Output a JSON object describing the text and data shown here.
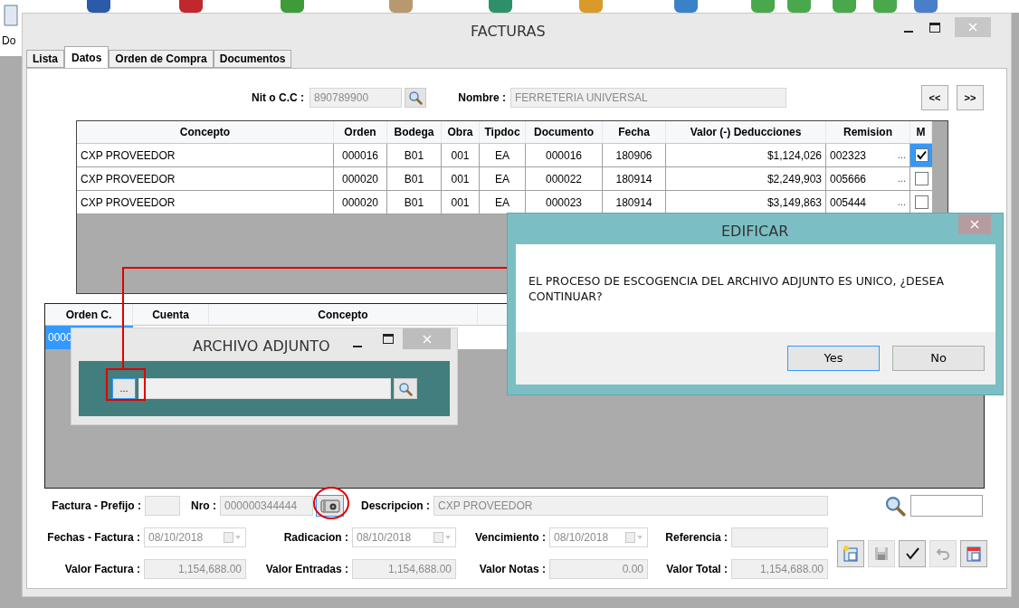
{
  "desktop": {
    "label": "Do"
  },
  "window": {
    "title": "FACTURAS"
  },
  "tabs": [
    {
      "label": "Lista",
      "selected": false
    },
    {
      "label": "Datos",
      "selected": true
    },
    {
      "label": "Orden de Compra",
      "selected": false
    },
    {
      "label": "Documentos",
      "selected": false
    }
  ],
  "header": {
    "nit_label": "Nit o C.C :",
    "nit_value": "890789900",
    "nombre_label": "Nombre :",
    "nombre_value": "FERRETERIA UNIVERSAL",
    "prev_button": "<<",
    "next_button": ">>"
  },
  "detail_table": {
    "columns": [
      "Concepto",
      "Orden",
      "Bodega",
      "Obra",
      "Tipdoc",
      "Documento",
      "Fecha",
      "Valor (-) Deducciones",
      "Remision",
      "M"
    ],
    "rows": [
      {
        "cells": [
          "CXP PROVEEDOR",
          "000016",
          "B01",
          "001",
          "EA",
          "000016",
          "180906",
          "$1,124,026",
          "002323"
        ],
        "remision_button": "...",
        "marked": true
      },
      {
        "cells": [
          "CXP PROVEEDOR",
          "000020",
          "B01",
          "001",
          "EA",
          "000022",
          "180914",
          "$2,249,903",
          "005666"
        ],
        "remision_button": "...",
        "marked": false
      },
      {
        "cells": [
          "CXP PROVEEDOR",
          "000020",
          "B01",
          "001",
          "EA",
          "000023",
          "180914",
          "$3,149,863",
          "005444"
        ],
        "remision_button": "...",
        "marked": false
      }
    ]
  },
  "orders_table": {
    "columns": [
      "Orden C.",
      "Cuenta",
      "Concepto"
    ],
    "rows": [
      {
        "cells": [
          "0000"
        ],
        "selected": true
      }
    ]
  },
  "form": {
    "rows": [
      [
        {
          "kind": "text",
          "label": "Factura - Prefijo :"
        },
        {
          "kind": "text",
          "label": "Nro :",
          "value": "000000344444"
        },
        {
          "kind": "camera"
        },
        {
          "kind": "text",
          "label": "Descripcion :",
          "value": "CXP PROVEEDOR"
        },
        {
          "kind": "search"
        }
      ],
      [
        {
          "kind": "date",
          "label": "Fechas - Factura :",
          "value": "08/10/2018"
        },
        {
          "kind": "date",
          "label": "Radicacion :",
          "value": "08/10/2018"
        },
        {
          "kind": "date",
          "label": "Vencimiento :",
          "value": "08/10/2018"
        },
        {
          "kind": "text",
          "label": "Referencia :"
        }
      ],
      [
        {
          "kind": "number",
          "label": "Valor Factura :",
          "value": "1,154,688.00"
        },
        {
          "kind": "number",
          "label": "Valor Entradas :",
          "value": "1,154,688.00"
        },
        {
          "kind": "number",
          "label": "Valor Notas :",
          "value": "0.00"
        },
        {
          "kind": "number",
          "label": "Valor Total :",
          "value": "1,154,688.00"
        }
      ]
    ]
  },
  "toolbar": [
    {
      "kind": "new",
      "disabled": false
    },
    {
      "kind": "save",
      "disabled": true
    },
    {
      "kind": "accept",
      "disabled": false
    },
    {
      "kind": "undo",
      "disabled": true
    },
    {
      "kind": "report",
      "disabled": false
    }
  ],
  "file_dialog": {
    "title": "ARCHIVO ADJUNTO",
    "browse_button": "..."
  },
  "confirm_dialog": {
    "title": "EDIFICAR",
    "message": "EL PROCESO DE ESCOGENCIA DEL ARCHIVO ADJUNTO ES UNICO, ¿DESEA CONTINUAR?",
    "buttons": [
      {
        "label": "Yes",
        "selected": true
      },
      {
        "label": "No",
        "selected": false
      }
    ]
  }
}
